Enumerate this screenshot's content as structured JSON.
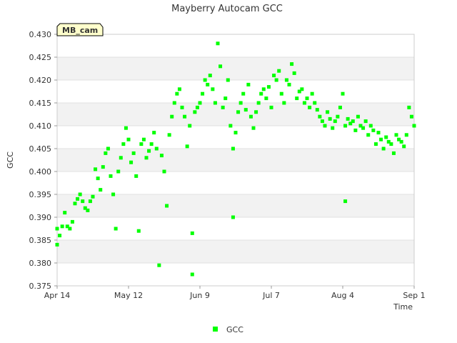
{
  "chart_data": {
    "type": "scatter",
    "title": "Mayberry Autocam GCC",
    "xlabel": "Time",
    "ylabel": "GCC",
    "xlim": [
      "2024-04-14",
      "2024-09-01"
    ],
    "ylim": [
      0.375,
      0.43
    ],
    "x_ticks": [
      "Apr 14",
      "May 12",
      "Jun 9",
      "Jul 7",
      "Aug 4",
      "Sep 1"
    ],
    "y_ticks": [
      "0.375",
      "0.380",
      "0.385",
      "0.390",
      "0.395",
      "0.400",
      "0.405",
      "0.410",
      "0.415",
      "0.420",
      "0.425",
      "0.430"
    ],
    "grid": true,
    "legend_position": "bottom-center",
    "annotation": "MB_cam",
    "series": [
      {
        "name": "GCC",
        "color": "#00ff00",
        "points": [
          [
            "2024-04-14",
            0.3875
          ],
          [
            "2024-04-14",
            0.384
          ],
          [
            "2024-04-15",
            0.386
          ],
          [
            "2024-04-16",
            0.388
          ],
          [
            "2024-04-17",
            0.391
          ],
          [
            "2024-04-18",
            0.388
          ],
          [
            "2024-04-19",
            0.3875
          ],
          [
            "2024-04-20",
            0.389
          ],
          [
            "2024-04-21",
            0.393
          ],
          [
            "2024-04-22",
            0.394
          ],
          [
            "2024-04-23",
            0.395
          ],
          [
            "2024-04-24",
            0.3935
          ],
          [
            "2024-04-25",
            0.392
          ],
          [
            "2024-04-26",
            0.3915
          ],
          [
            "2024-04-27",
            0.3935
          ],
          [
            "2024-04-28",
            0.3945
          ],
          [
            "2024-04-29",
            0.4005
          ],
          [
            "2024-04-30",
            0.3985
          ],
          [
            "2024-05-01",
            0.396
          ],
          [
            "2024-05-02",
            0.401
          ],
          [
            "2024-05-03",
            0.404
          ],
          [
            "2024-05-04",
            0.405
          ],
          [
            "2024-05-05",
            0.399
          ],
          [
            "2024-05-06",
            0.395
          ],
          [
            "2024-05-07",
            0.3875
          ],
          [
            "2024-05-08",
            0.4
          ],
          [
            "2024-05-09",
            0.403
          ],
          [
            "2024-05-10",
            0.406
          ],
          [
            "2024-05-11",
            0.4095
          ],
          [
            "2024-05-12",
            0.407
          ],
          [
            "2024-05-13",
            0.402
          ],
          [
            "2024-05-14",
            0.404
          ],
          [
            "2024-05-15",
            0.399
          ],
          [
            "2024-05-16",
            0.387
          ],
          [
            "2024-05-17",
            0.406
          ],
          [
            "2024-05-18",
            0.407
          ],
          [
            "2024-05-19",
            0.403
          ],
          [
            "2024-05-20",
            0.4045
          ],
          [
            "2024-05-21",
            0.406
          ],
          [
            "2024-05-22",
            0.4085
          ],
          [
            "2024-05-23",
            0.405
          ],
          [
            "2024-05-24",
            0.3795
          ],
          [
            "2024-05-25",
            0.4035
          ],
          [
            "2024-05-26",
            0.4
          ],
          [
            "2024-05-27",
            0.3925
          ],
          [
            "2024-05-28",
            0.408
          ],
          [
            "2024-05-29",
            0.412
          ],
          [
            "2024-05-30",
            0.415
          ],
          [
            "2024-05-31",
            0.417
          ],
          [
            "2024-06-01",
            0.418
          ],
          [
            "2024-06-02",
            0.414
          ],
          [
            "2024-06-03",
            0.412
          ],
          [
            "2024-06-04",
            0.4055
          ],
          [
            "2024-06-05",
            0.41
          ],
          [
            "2024-06-06",
            0.3775
          ],
          [
            "2024-06-06",
            0.3865
          ],
          [
            "2024-06-07",
            0.413
          ],
          [
            "2024-06-08",
            0.414
          ],
          [
            "2024-06-09",
            0.415
          ],
          [
            "2024-06-10",
            0.417
          ],
          [
            "2024-06-11",
            0.42
          ],
          [
            "2024-06-12",
            0.419
          ],
          [
            "2024-06-13",
            0.421
          ],
          [
            "2024-06-14",
            0.418
          ],
          [
            "2024-06-15",
            0.415
          ],
          [
            "2024-06-16",
            0.428
          ],
          [
            "2024-06-17",
            0.423
          ],
          [
            "2024-06-18",
            0.414
          ],
          [
            "2024-06-19",
            0.416
          ],
          [
            "2024-06-20",
            0.42
          ],
          [
            "2024-06-21",
            0.41
          ],
          [
            "2024-06-22",
            0.405
          ],
          [
            "2024-06-22",
            0.39
          ],
          [
            "2024-06-23",
            0.4085
          ],
          [
            "2024-06-24",
            0.413
          ],
          [
            "2024-06-25",
            0.415
          ],
          [
            "2024-06-26",
            0.417
          ],
          [
            "2024-06-27",
            0.4135
          ],
          [
            "2024-06-28",
            0.419
          ],
          [
            "2024-06-29",
            0.412
          ],
          [
            "2024-06-30",
            0.4095
          ],
          [
            "2024-07-01",
            0.413
          ],
          [
            "2024-07-02",
            0.415
          ],
          [
            "2024-07-03",
            0.417
          ],
          [
            "2024-07-04",
            0.418
          ],
          [
            "2024-07-05",
            0.416
          ],
          [
            "2024-07-06",
            0.4185
          ],
          [
            "2024-07-07",
            0.414
          ],
          [
            "2024-07-08",
            0.421
          ],
          [
            "2024-07-09",
            0.42
          ],
          [
            "2024-07-10",
            0.422
          ],
          [
            "2024-07-11",
            0.417
          ],
          [
            "2024-07-12",
            0.415
          ],
          [
            "2024-07-13",
            0.42
          ],
          [
            "2024-07-14",
            0.419
          ],
          [
            "2024-07-15",
            0.4235
          ],
          [
            "2024-07-16",
            0.4215
          ],
          [
            "2024-07-17",
            0.416
          ],
          [
            "2024-07-18",
            0.4175
          ],
          [
            "2024-07-19",
            0.418
          ],
          [
            "2024-07-20",
            0.415
          ],
          [
            "2024-07-21",
            0.416
          ],
          [
            "2024-07-22",
            0.414
          ],
          [
            "2024-07-23",
            0.417
          ],
          [
            "2024-07-24",
            0.415
          ],
          [
            "2024-07-25",
            0.4135
          ],
          [
            "2024-07-26",
            0.412
          ],
          [
            "2024-07-27",
            0.411
          ],
          [
            "2024-07-28",
            0.41
          ],
          [
            "2024-07-29",
            0.413
          ],
          [
            "2024-07-30",
            0.4115
          ],
          [
            "2024-07-31",
            0.4095
          ],
          [
            "2024-08-01",
            0.411
          ],
          [
            "2024-08-02",
            0.412
          ],
          [
            "2024-08-03",
            0.414
          ],
          [
            "2024-08-04",
            0.417
          ],
          [
            "2024-08-05",
            0.41
          ],
          [
            "2024-08-05",
            0.3935
          ],
          [
            "2024-08-06",
            0.4115
          ],
          [
            "2024-08-07",
            0.4105
          ],
          [
            "2024-08-08",
            0.411
          ],
          [
            "2024-08-09",
            0.409
          ],
          [
            "2024-08-10",
            0.412
          ],
          [
            "2024-08-11",
            0.41
          ],
          [
            "2024-08-12",
            0.4095
          ],
          [
            "2024-08-13",
            0.411
          ],
          [
            "2024-08-14",
            0.408
          ],
          [
            "2024-08-15",
            0.41
          ],
          [
            "2024-08-16",
            0.409
          ],
          [
            "2024-08-17",
            0.406
          ],
          [
            "2024-08-18",
            0.4085
          ],
          [
            "2024-08-19",
            0.407
          ],
          [
            "2024-08-20",
            0.405
          ],
          [
            "2024-08-21",
            0.4075
          ],
          [
            "2024-08-22",
            0.4065
          ],
          [
            "2024-08-23",
            0.406
          ],
          [
            "2024-08-24",
            0.404
          ],
          [
            "2024-08-25",
            0.408
          ],
          [
            "2024-08-26",
            0.407
          ],
          [
            "2024-08-27",
            0.4065
          ],
          [
            "2024-08-28",
            0.4055
          ],
          [
            "2024-08-29",
            0.408
          ],
          [
            "2024-08-30",
            0.414
          ],
          [
            "2024-08-31",
            0.412
          ],
          [
            "2024-09-01",
            0.41
          ]
        ]
      }
    ]
  }
}
